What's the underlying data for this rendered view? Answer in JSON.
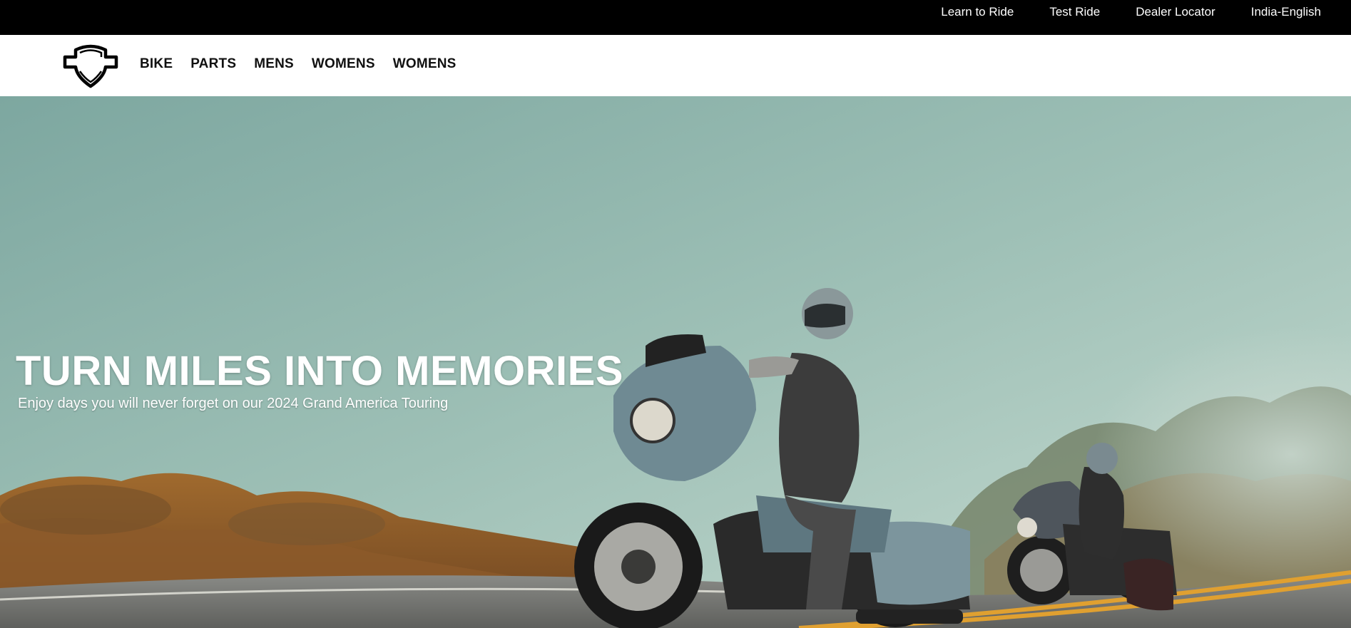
{
  "utility_nav": {
    "items": [
      {
        "label": "Learn to Ride"
      },
      {
        "label": "Test Ride"
      },
      {
        "label": "Dealer Locator"
      },
      {
        "label": "India-English"
      }
    ]
  },
  "main_nav": {
    "logo_icon": "bar-and-shield-logo-icon",
    "items": [
      {
        "label": "BIKE"
      },
      {
        "label": "PARTS"
      },
      {
        "label": "MENS"
      },
      {
        "label": "WOMENS"
      },
      {
        "label": "WOMENS"
      }
    ]
  },
  "hero": {
    "title": "TURN MILES INTO MEMORIES",
    "subtitle": "Enjoy days you will never forget on our 2024 Grand America Touring"
  },
  "colors": {
    "top_bar": "#000000",
    "nav_bg": "#FFFFFF",
    "nav_text": "#111111",
    "hero_text": "#FFFFFF",
    "road_line": "#E0A030",
    "sky": "#8FB5AD",
    "bike_body": "#6F8A93"
  }
}
